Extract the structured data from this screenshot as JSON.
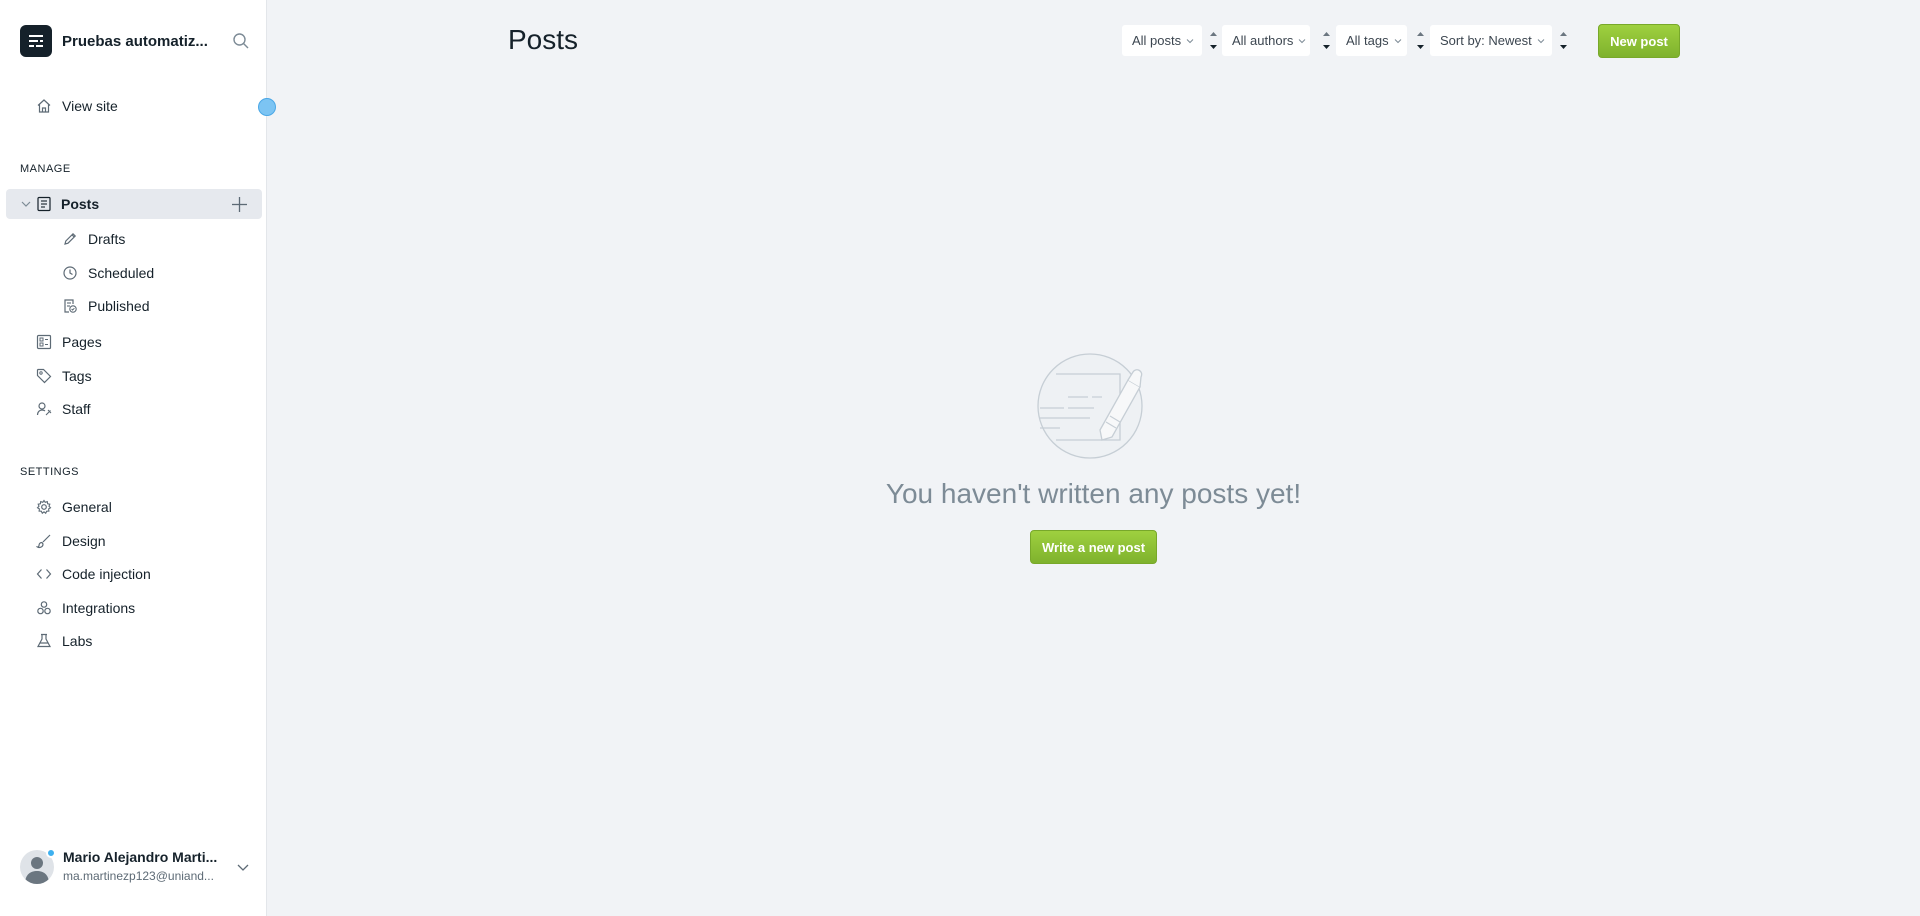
{
  "brand": {
    "name": "Pruebas automatiz..."
  },
  "nav": {
    "view_site": "View site",
    "manage_label": "MANAGE",
    "posts": "Posts",
    "drafts": "Drafts",
    "scheduled": "Scheduled",
    "published": "Published",
    "pages": "Pages",
    "tags": "Tags",
    "staff": "Staff",
    "settings_label": "SETTINGS",
    "general": "General",
    "design": "Design",
    "code_injection": "Code injection",
    "integrations": "Integrations",
    "labs": "Labs"
  },
  "user": {
    "name": "Mario Alejandro Marti...",
    "email": "ma.martinezp123@uniand..."
  },
  "main": {
    "title": "Posts",
    "filters": {
      "type": "All posts",
      "authors": "All authors",
      "tags": "All tags",
      "sort": "Sort by: Newest"
    },
    "new_post": "New post",
    "empty_message": "You haven't written any posts yet!",
    "write_new_post": "Write a new post"
  },
  "colors": {
    "accent_green": "#9fd03f",
    "sidebar_bg": "#ffffff",
    "main_bg": "#f1f3f6",
    "active_item_bg": "#e6e9ee"
  },
  "icons": {
    "brand": "ghost-logo-icon",
    "search": "search-icon",
    "home": "home-icon",
    "posts": "posts-icon",
    "drafts": "pencil-icon",
    "scheduled": "clock-icon",
    "published": "published-icon",
    "pages": "pages-icon",
    "tags": "tag-icon",
    "staff": "staff-icon",
    "general": "gear-icon",
    "design": "brush-icon",
    "code_injection": "code-icon",
    "integrations": "integrations-icon",
    "labs": "flask-icon"
  }
}
